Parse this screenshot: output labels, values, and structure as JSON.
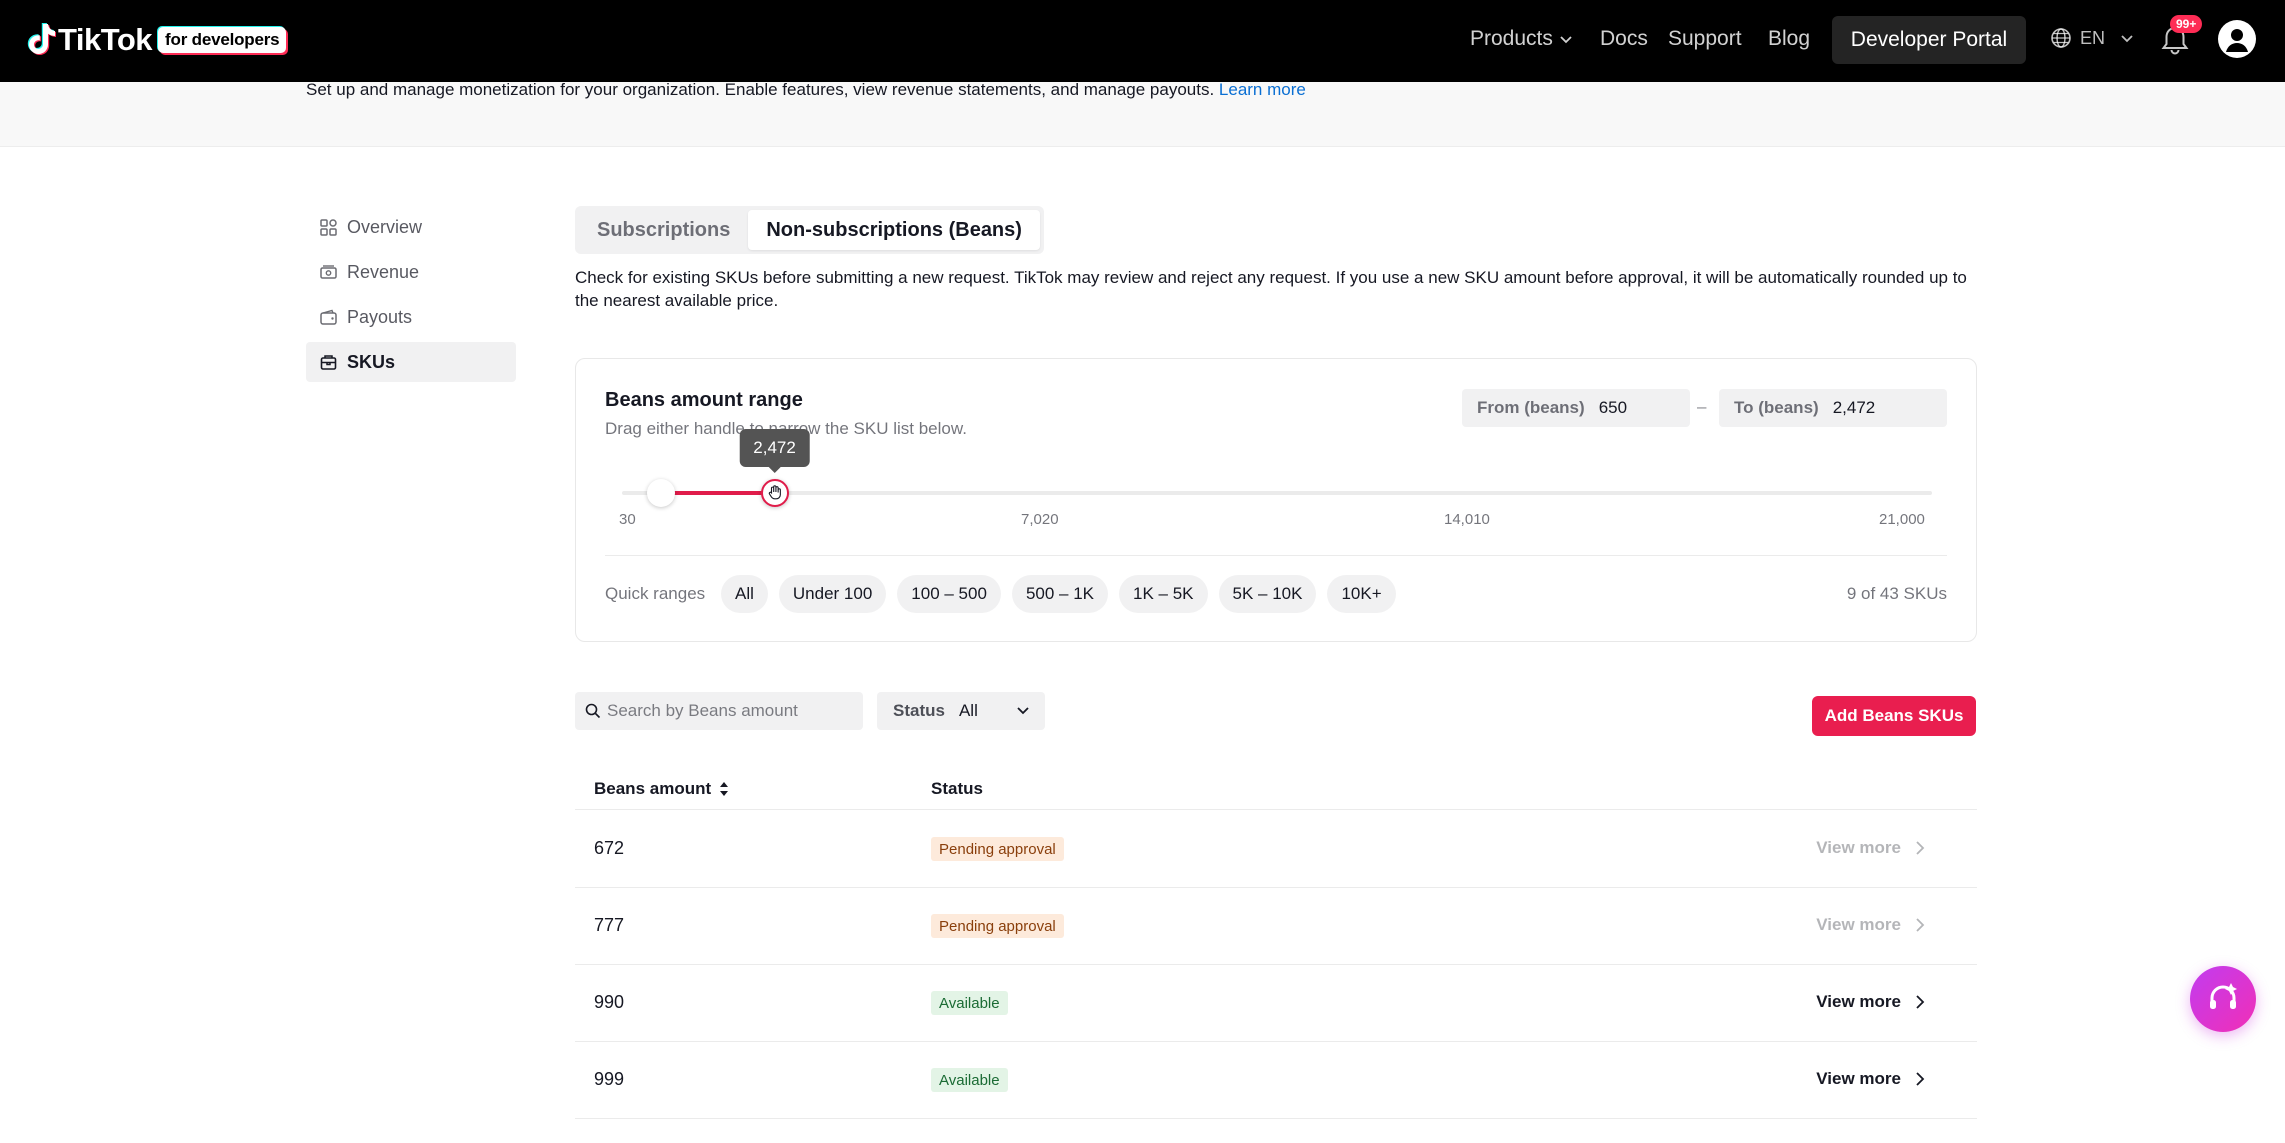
{
  "navbar": {
    "logo_text": "TikTok",
    "logo_badge": "for developers",
    "links": {
      "products": "Products",
      "docs": "Docs",
      "support": "Support",
      "blog": "Blog"
    },
    "developer_portal": "Developer Portal",
    "language": "EN",
    "notifications_badge": "99+"
  },
  "intro": {
    "text": "Set up and manage monetization for your organization. Enable features, view revenue statements, and manage payouts. ",
    "learn_more": "Learn more"
  },
  "sidebar": {
    "items": [
      {
        "label": "Overview",
        "icon": "grid-icon",
        "active": false
      },
      {
        "label": "Revenue",
        "icon": "banknote-icon",
        "active": false
      },
      {
        "label": "Payouts",
        "icon": "wallet-icon",
        "active": false
      },
      {
        "label": "SKUs",
        "icon": "box-icon",
        "active": true
      }
    ]
  },
  "tabs": [
    {
      "label": "Subscriptions",
      "active": false
    },
    {
      "label": "Non-subscriptions (Beans)",
      "active": true
    }
  ],
  "description": "Check for existing SKUs before submitting a new request. TikTok may review and reject any request. If you use a new SKU amount before approval, it will be automatically rounded up to the nearest available price.",
  "range": {
    "title": "Beans amount range",
    "subtitle": "Drag either handle to narrow the SKU list below.",
    "from_label": "From (beans)",
    "from_value": "650",
    "to_label": "To (beans)",
    "to_value": "2,472",
    "separator": "–",
    "min": 30,
    "max": 21000,
    "low": 650,
    "high": 2472,
    "tooltip": "2,472",
    "ticks": [
      "30",
      "7,020",
      "14,010",
      "21,000"
    ],
    "quick_label": "Quick ranges",
    "quick_ranges": [
      "All",
      "Under 100",
      "100 – 500",
      "500 – 1K",
      "1K – 5K",
      "5K – 10K",
      "10K+"
    ],
    "count": "9 of 43 SKUs"
  },
  "filters": {
    "search_placeholder": "Search by Beans amount",
    "status_label": "Status",
    "status_value": "All",
    "add_button": "Add Beans SKUs"
  },
  "table": {
    "headers": {
      "amount": "Beans amount",
      "status": "Status"
    },
    "view_more": "View more",
    "rows": [
      {
        "amount": "672",
        "status": "Pending approval",
        "status_kind": "pending",
        "view_enabled": false
      },
      {
        "amount": "777",
        "status": "Pending approval",
        "status_kind": "pending",
        "view_enabled": false
      },
      {
        "amount": "990",
        "status": "Available",
        "status_kind": "available",
        "view_enabled": true
      },
      {
        "amount": "999",
        "status": "Available",
        "status_kind": "available",
        "view_enabled": true
      }
    ]
  },
  "colors": {
    "accent": "#e91e4f",
    "pending_bg": "#fdeadb",
    "available_bg": "#e3f4e6"
  }
}
